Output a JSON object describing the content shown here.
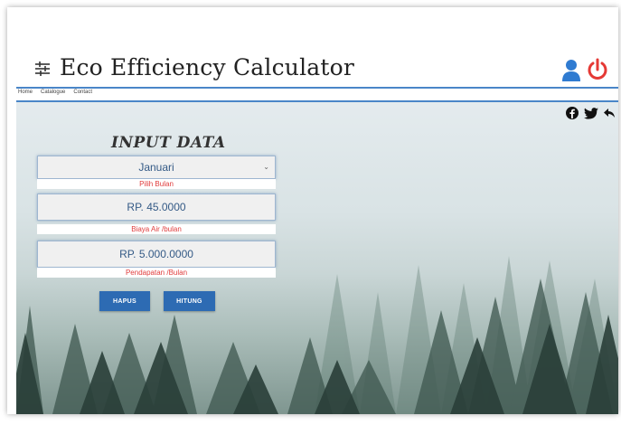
{
  "header": {
    "title": "Eco Efficiency Calculator",
    "menu_icon": "sliders-icon",
    "user_icon": "user-icon",
    "power_icon": "power-icon"
  },
  "nav": {
    "items": [
      {
        "label": "Home"
      },
      {
        "label": "Catalogue"
      },
      {
        "label": "Contact"
      }
    ]
  },
  "social": [
    "facebook-icon",
    "twitter-icon",
    "share-icon"
  ],
  "form": {
    "title": "INPUT DATA",
    "month": {
      "value": "Januari",
      "helper": "Pilih Bulan"
    },
    "water_cost": {
      "value": "RP. 45.0000",
      "helper": "Biaya Air /bulan"
    },
    "income": {
      "value": "RP. 5.000.0000",
      "helper": "Pendapatan /Bulan"
    },
    "buttons": {
      "clear": "HAPUS",
      "calculate": "HITUNG"
    }
  },
  "colors": {
    "accent": "#2d6bb3",
    "divider": "#4a86c8",
    "helper_text": "#e03c3c",
    "power": "#e53935",
    "user": "#2f7bd1"
  }
}
